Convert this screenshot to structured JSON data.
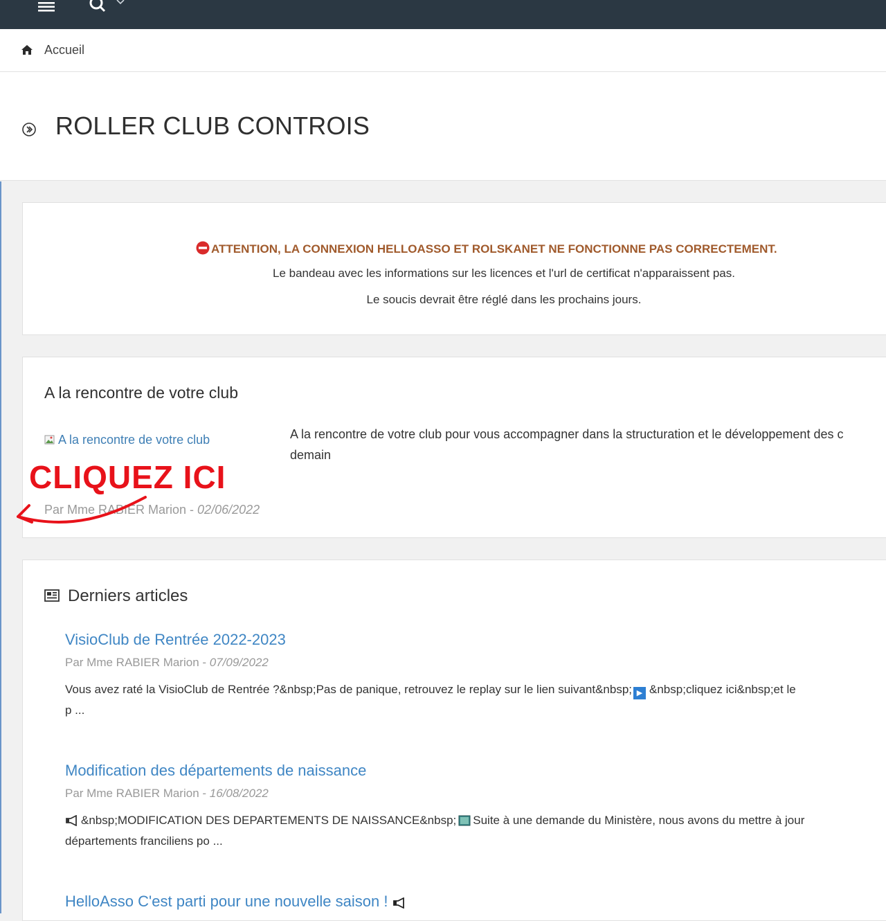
{
  "breadcrumb": {
    "home": "Accueil"
  },
  "page": {
    "title": "ROLLER CLUB CONTROIS"
  },
  "alert": {
    "title": "ATTENTION, LA CONNEXION HELLOASSO ET ROLSKANET NE FONCTIONNE PAS CORRECTEMENT.",
    "line1": "Le bandeau avec les informations sur les licences et l'url de certificat n'apparaissent pas.",
    "line2": "Le soucis devrait être réglé dans les prochains jours."
  },
  "club": {
    "heading": "A la rencontre de votre club",
    "image_alt": "A la rencontre de votre club",
    "text_line1": "A la rencontre de votre club pour vous accompagner dans la structuration et le développement des c",
    "text_line2": "demain",
    "author": "Par Mme RABIER Marion - ",
    "date": "02/06/2022"
  },
  "overlay": {
    "cta": "CLIQUEZ ICI"
  },
  "articles": {
    "heading": "Derniers articles",
    "items": [
      {
        "title": "VisioClub de Rentrée 2022-2023",
        "author": "Par Mme RABIER Marion - ",
        "date": "07/09/2022",
        "excerpt_a": "Vous avez raté la VisioClub de Rentrée ?&nbsp;Pas de panique, retrouvez le replay sur le lien suivant&nbsp;",
        "excerpt_b": "&nbsp;cliquez ici&nbsp;et le",
        "excerpt_line2": "p ..."
      },
      {
        "title": "Modification des départements de naissance",
        "author": "Par Mme RABIER Marion - ",
        "date": "16/08/2022",
        "excerpt_a": "&nbsp;MODIFICATION DES DEPARTEMENTS DE NAISSANCE&nbsp;",
        "excerpt_b": "Suite à une demande du Ministère, nous avons du mettre à jour",
        "excerpt_line2": "départements franciliens po ..."
      },
      {
        "title": "HelloAsso C'est parti pour une nouvelle saison !"
      }
    ]
  }
}
